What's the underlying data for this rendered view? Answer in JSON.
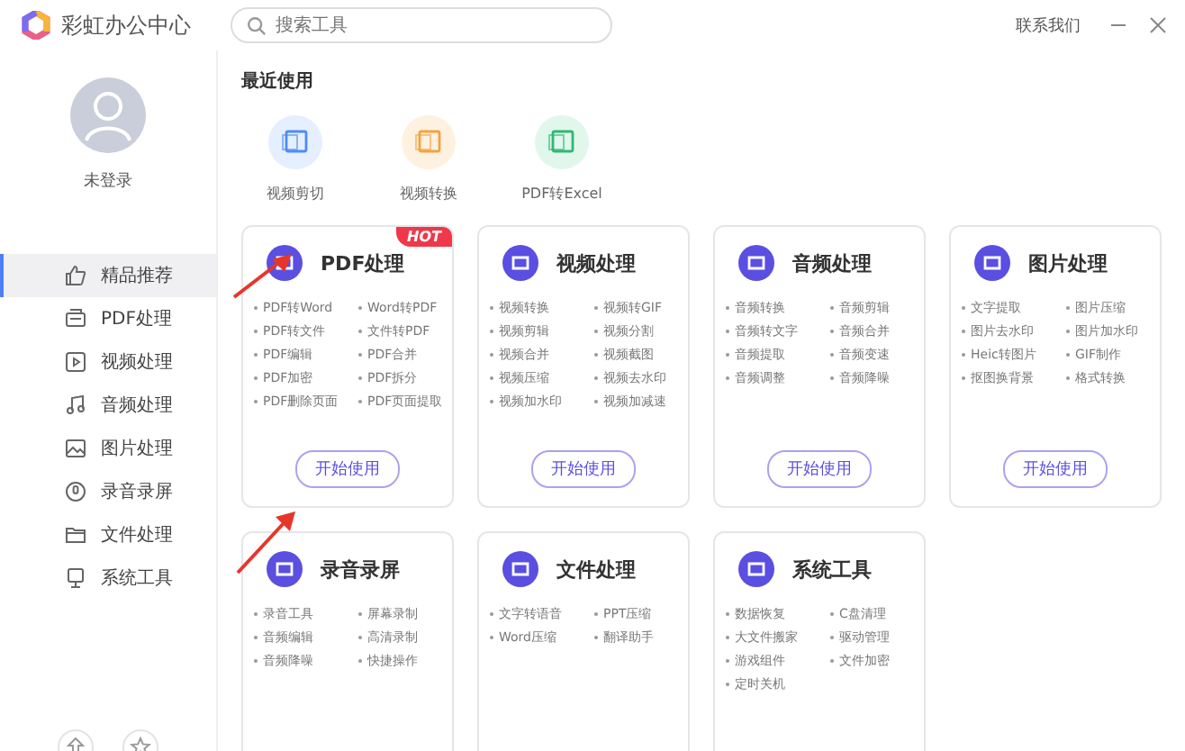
{
  "app": {
    "name": "彩虹办公中心"
  },
  "search": {
    "placeholder": "搜索工具"
  },
  "header": {
    "contact": "联系我们"
  },
  "user": {
    "name": "未登录"
  },
  "sidebar": {
    "items": [
      {
        "label": "精品推荐",
        "selected": true
      },
      {
        "label": "PDF处理",
        "selected": false
      },
      {
        "label": "视频处理",
        "selected": false
      },
      {
        "label": "音频处理",
        "selected": false
      },
      {
        "label": "图片处理",
        "selected": false
      },
      {
        "label": "录音录屏",
        "selected": false
      },
      {
        "label": "文件处理",
        "selected": false
      },
      {
        "label": "系统工具",
        "selected": false
      }
    ]
  },
  "recent": {
    "title": "最近使用",
    "items": [
      {
        "label": "视频剪切"
      },
      {
        "label": "视频转换"
      },
      {
        "label": "PDF转Excel"
      }
    ]
  },
  "cards": [
    {
      "title": "PDF处理",
      "badge": "HOT",
      "items": [
        "PDF转Word",
        "Word转PDF",
        "PDF转文件",
        "文件转PDF",
        "PDF编辑",
        "PDF合并",
        "PDF加密",
        "PDF拆分",
        "PDF删除页面",
        "PDF页面提取"
      ],
      "button": "开始使用"
    },
    {
      "title": "视频处理",
      "items": [
        "视频转换",
        "视频转GIF",
        "视频剪辑",
        "视频分割",
        "视频合并",
        "视频截图",
        "视频压缩",
        "视频去水印",
        "视频加水印",
        "视频加减速"
      ],
      "button": "开始使用"
    },
    {
      "title": "音频处理",
      "items": [
        "音频转换",
        "音频剪辑",
        "音频转文字",
        "音频合并",
        "音频提取",
        "音频变速",
        "音频调整",
        "音频降噪"
      ],
      "button": "开始使用"
    },
    {
      "title": "图片处理",
      "items": [
        "文字提取",
        "图片压缩",
        "图片去水印",
        "图片加水印",
        "Heic转图片",
        "GIF制作",
        "抠图换背景",
        "格式转换"
      ],
      "button": "开始使用"
    },
    {
      "title": "录音录屏",
      "items": [
        "录音工具",
        "屏幕录制",
        "音频编辑",
        "高清录制",
        "音频降噪",
        "快捷操作"
      ]
    },
    {
      "title": "文件处理",
      "items": [
        "文字转语音",
        "PPT压缩",
        "Word压缩",
        "翻译助手"
      ]
    },
    {
      "title": "系统工具",
      "items": [
        "数据恢复",
        "C盘清理",
        "大文件搬家",
        "驱动管理",
        "游戏组件",
        "文件加密",
        "定时关机"
      ]
    }
  ]
}
